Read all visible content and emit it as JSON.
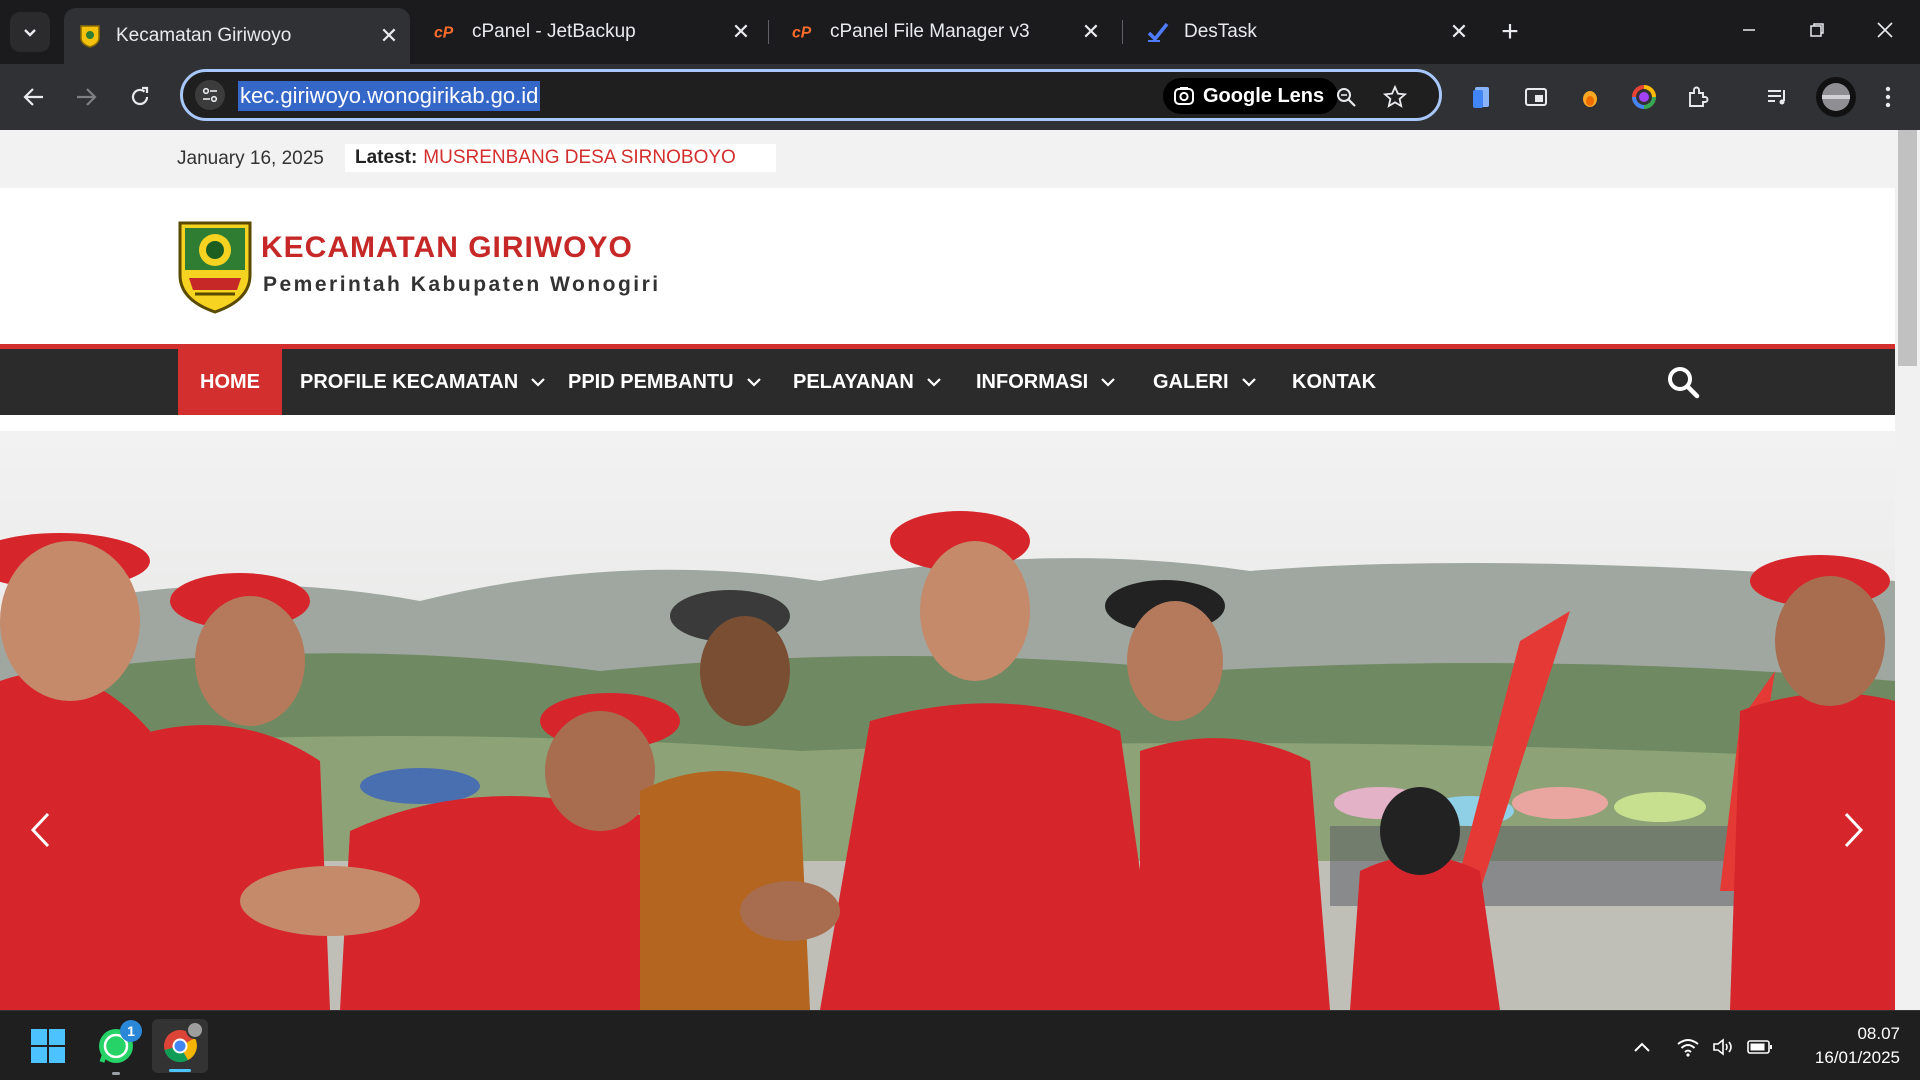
{
  "browser": {
    "tabs": [
      {
        "title": "Kecamatan Giriwoyo",
        "active": true,
        "favicon": "shield-logo-icon"
      },
      {
        "title": "cPanel - JetBackup",
        "active": false,
        "favicon": "cpanel-icon"
      },
      {
        "title": "cPanel File Manager v3",
        "active": false,
        "favicon": "cpanel-icon"
      },
      {
        "title": "DesTask",
        "active": false,
        "favicon": "destask-icon"
      }
    ],
    "address": "kec.giriwoyo.wonogirikab.go.id",
    "lens_label": "Google Lens"
  },
  "page": {
    "topbar": {
      "date": "January 16, 2025",
      "latest_label": "Latest:",
      "latest_news": "MUSRENBANG DESA SIRNOBOYO"
    },
    "header": {
      "title": "KECAMATAN GIRIWOYO",
      "tagline": "Pemerintah Kabupaten Wonogiri"
    },
    "nav": [
      {
        "label": "HOME",
        "has_dropdown": false
      },
      {
        "label": "PROFILE KECAMATAN",
        "has_dropdown": true
      },
      {
        "label": "PPID PEMBANTU",
        "has_dropdown": true
      },
      {
        "label": "PELAYANAN",
        "has_dropdown": true
      },
      {
        "label": "INFORMASI",
        "has_dropdown": true
      },
      {
        "label": "GALERI",
        "has_dropdown": true
      },
      {
        "label": "KONTAK",
        "has_dropdown": false
      }
    ]
  },
  "taskbar": {
    "whatsapp_badge": "1",
    "time": "08.07",
    "date": "16/01/2025"
  },
  "colors": {
    "accent_red": "#d32f2f",
    "nav_bg": "#2b2b2b",
    "omnibox_border": "#a8c7fa"
  }
}
